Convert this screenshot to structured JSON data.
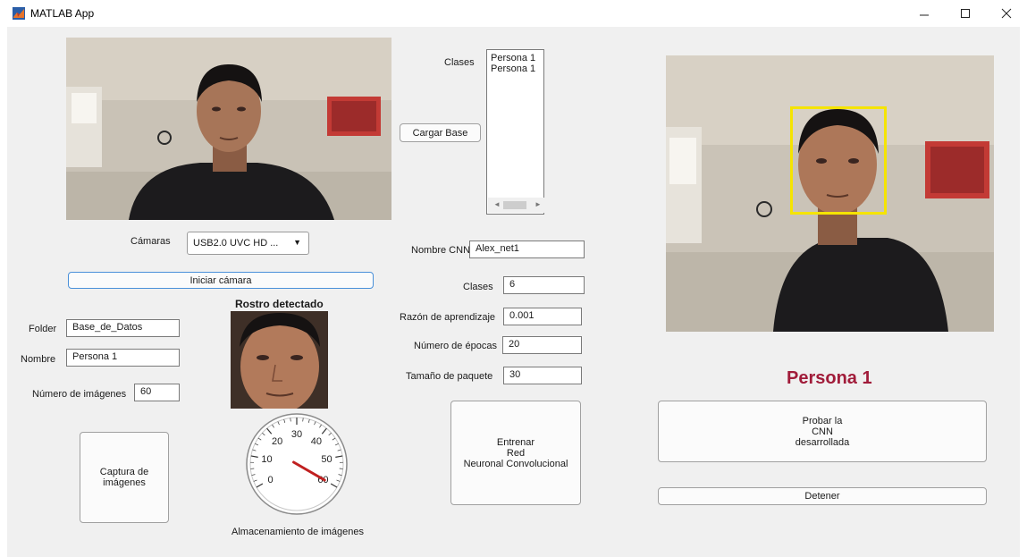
{
  "window": {
    "title": "MATLAB App"
  },
  "left": {
    "camaras_label": "Cámaras",
    "camaras_value": "USB2.0 UVC HD ...",
    "iniciar_camara": "Iniciar cámara",
    "rostro_detectado": "Rostro detectado",
    "folder_label": "Folder",
    "folder_value": "Base_de_Datos",
    "nombre_label": "Nombre",
    "nombre_value": "Persona 1",
    "num_imagenes_label": "Número de imágenes",
    "num_imagenes_value": "60",
    "captura_button": "Captura de\nimágenes",
    "gauge_label": "Almacenamiento de imágenes",
    "gauge": {
      "min": 0,
      "max": 60,
      "value": 60,
      "ticks": [
        "0",
        "10",
        "20",
        "30",
        "40",
        "50",
        "60"
      ]
    }
  },
  "middle": {
    "clases_list_label": "Clases",
    "clases_list_items": [
      "Persona 1",
      "Persona 1"
    ],
    "cargar_base": "Cargar Base",
    "nombre_cnn_label": "Nombre CNN",
    "nombre_cnn_value": "Alex_net1",
    "clases_label": "Clases",
    "clases_value": "6",
    "razon_label": "Razón de aprendizaje",
    "razon_value": "0.001",
    "epocas_label": "Número de épocas",
    "epocas_value": "20",
    "paquete_label": "Tamaño de paquete",
    "paquete_value": "30",
    "entrenar_button": "Entrenar\nRed\nNeuronal Convolucional"
  },
  "right": {
    "result_label": "Persona 1",
    "probar_button": "Probar la\nCNN\ndesarrollada",
    "detener_button": "Detener"
  },
  "colors": {
    "accent": "#a11c3a",
    "face_box": "#f5e400",
    "primary_border": "#4a90d9"
  }
}
